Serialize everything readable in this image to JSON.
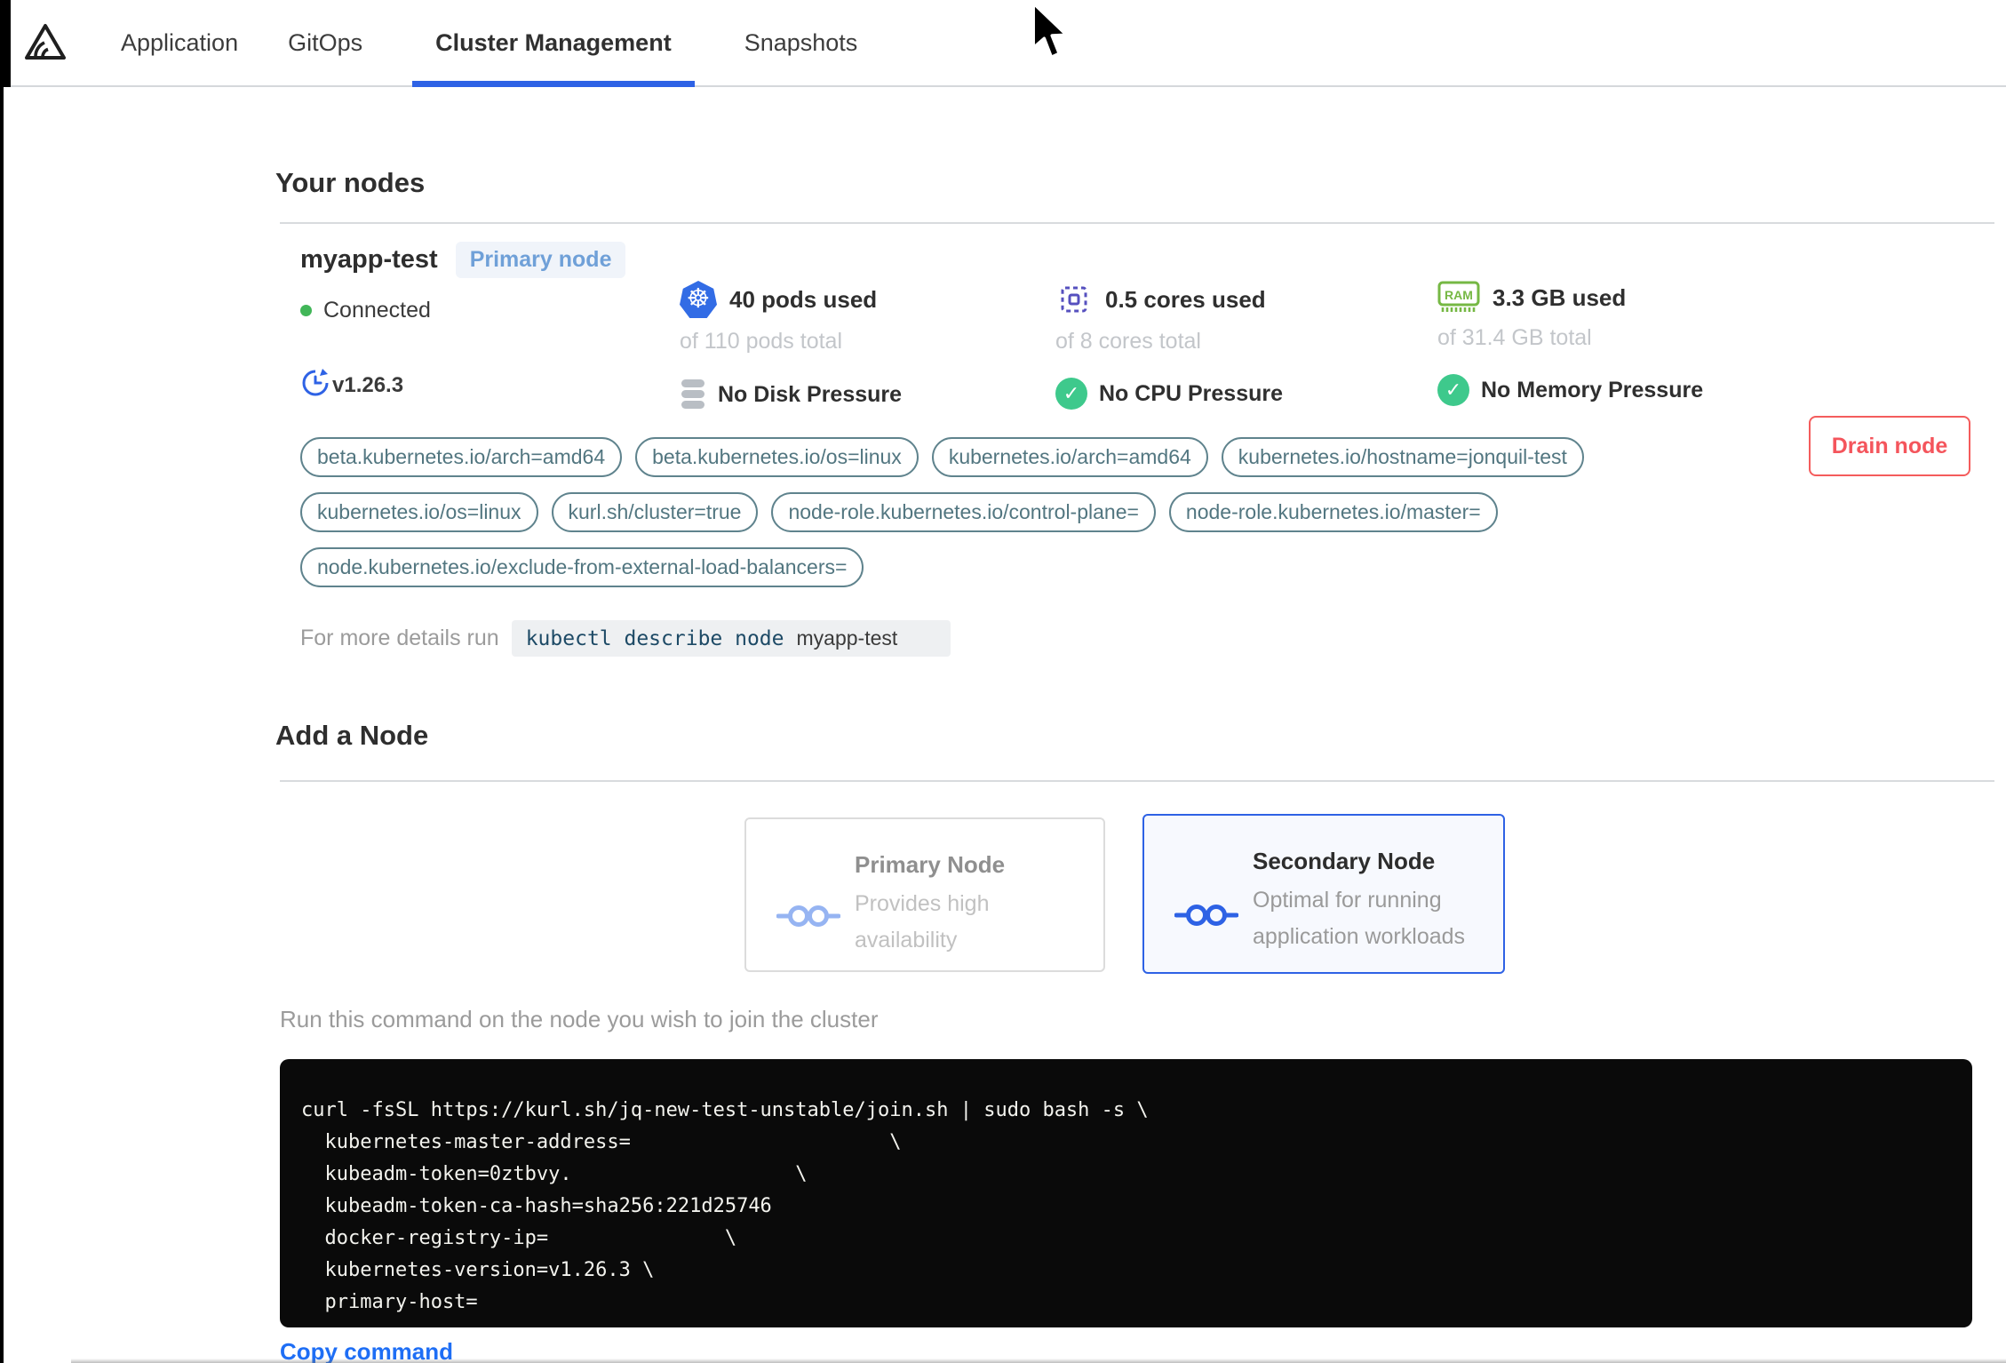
{
  "nav": {
    "tabs": [
      {
        "label": "Application",
        "active": false
      },
      {
        "label": "GitOps",
        "active": false
      },
      {
        "label": "Cluster Management",
        "active": true
      },
      {
        "label": "Snapshots",
        "active": false
      }
    ]
  },
  "your_nodes": {
    "title": "Your nodes",
    "node": {
      "name": "myapp-test",
      "badge": "Primary node",
      "status": "Connected",
      "version": "v1.26.3",
      "pods": {
        "used": "40 pods used",
        "total": "of 110 pods total"
      },
      "cpu": {
        "used": "0.5 cores used",
        "total": "of 8 cores total"
      },
      "memory": {
        "used": "3.3 GB used",
        "total": "of 31.4 GB total"
      },
      "pressures": {
        "disk": "No Disk Pressure",
        "cpu": "No CPU Pressure",
        "memory": "No Memory Pressure"
      },
      "labels": [
        "beta.kubernetes.io/arch=amd64",
        "beta.kubernetes.io/os=linux",
        "kubernetes.io/arch=amd64",
        "kubernetes.io/hostname=jonquil-test",
        "kubernetes.io/os=linux",
        "kurl.sh/cluster=true",
        "node-role.kubernetes.io/control-plane=",
        "node-role.kubernetes.io/master=",
        "node.kubernetes.io/exclude-from-external-load-balancers="
      ],
      "details": {
        "prefix": "For more details run",
        "command": "kubectl describe node",
        "arg": "myapp-test"
      },
      "drain_label": "Drain node"
    }
  },
  "add_node": {
    "title": "Add a Node",
    "options": [
      {
        "title": "Primary Node",
        "desc": "Provides high availability",
        "selected": false
      },
      {
        "title": "Secondary Node",
        "desc": "Optimal for running application workloads",
        "selected": true
      }
    ],
    "hint": "Run this command on the node you wish to join the cluster",
    "command_lines": [
      "curl -fsSL https://kurl.sh/jq-new-test-unstable/join.sh | sudo bash -s \\",
      "  kubernetes-master-address=                      \\",
      "  kubeadm-token=0ztbvy.                   \\",
      "  kubeadm-token-ca-hash=sha256:221d25746",
      "  docker-registry-ip=               \\",
      "  kubernetes-version=v1.26.3 \\",
      "  primary-host="
    ],
    "copy_label": "Copy command"
  },
  "glyphs": {
    "kubernetes": "☸",
    "check": "✓",
    "ram_text": "RAM"
  },
  "colors": {
    "accent": "#2e62e5",
    "danger": "#f4555c",
    "success": "#3ec98c",
    "connected_green": "#41b658",
    "chip_teal": "#527680",
    "kubernetes_blue": "#326ce5",
    "cpu_purple": "#5650bf",
    "ram_green": "#76b844",
    "badge_blue": "#6fa0d8"
  }
}
